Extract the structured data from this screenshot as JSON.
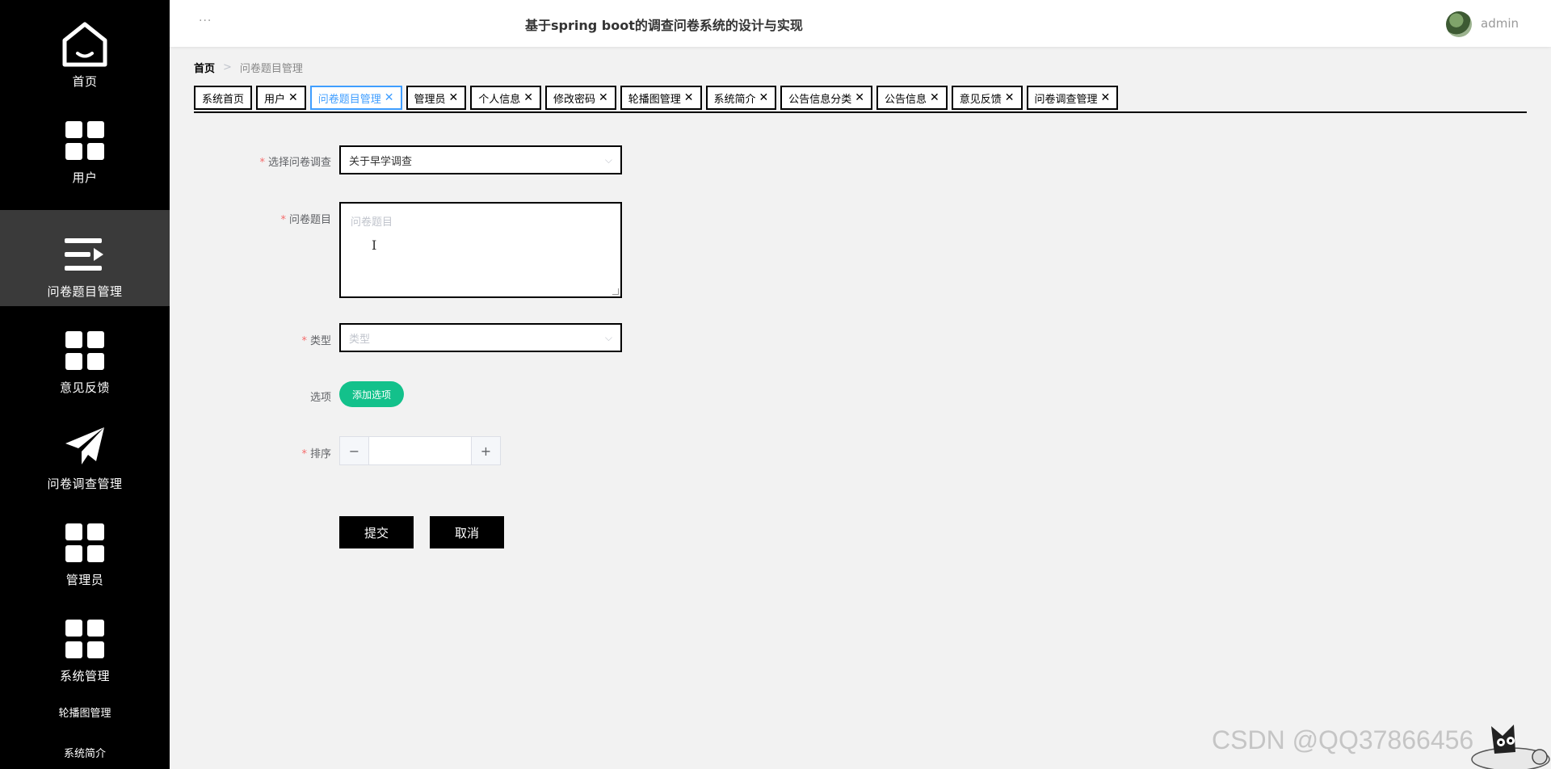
{
  "header": {
    "title": "基于spring boot的调查问卷系统的设计与实现",
    "username": "admin",
    "menu_dots": "···"
  },
  "sidebar": {
    "items": [
      {
        "label": "首页",
        "icon": "home-icon"
      },
      {
        "label": "用户",
        "icon": "grid-icon"
      },
      {
        "label": "问卷题目管理",
        "icon": "list-arrow-icon",
        "active": true
      },
      {
        "label": "意见反馈",
        "icon": "grid-icon"
      },
      {
        "label": "问卷调查管理",
        "icon": "paper-plane-icon"
      },
      {
        "label": "管理员",
        "icon": "grid-icon"
      },
      {
        "label": "系统管理",
        "icon": "grid-icon"
      }
    ],
    "subitems": [
      "轮播图管理",
      "系统简介"
    ]
  },
  "breadcrumb": {
    "home": "首页",
    "separator": ">",
    "current": "问卷题目管理"
  },
  "tabs": [
    {
      "label": "系统首页",
      "closable": false
    },
    {
      "label": "用户",
      "closable": true
    },
    {
      "label": "问卷题目管理",
      "closable": true,
      "active": true
    },
    {
      "label": "管理员",
      "closable": true
    },
    {
      "label": "个人信息",
      "closable": true
    },
    {
      "label": "修改密码",
      "closable": true
    },
    {
      "label": "轮播图管理",
      "closable": true
    },
    {
      "label": "系统简介",
      "closable": true
    },
    {
      "label": "公告信息分类",
      "closable": true
    },
    {
      "label": "公告信息",
      "closable": true
    },
    {
      "label": "意见反馈",
      "closable": true
    },
    {
      "label": "问卷调查管理",
      "closable": true
    }
  ],
  "tab_close": "✕",
  "form": {
    "survey": {
      "label": "选择问卷调查",
      "value": "关于早学调查"
    },
    "question": {
      "label": "问卷题目",
      "placeholder": "问卷题目"
    },
    "type": {
      "label": "类型",
      "placeholder": "类型"
    },
    "options": {
      "label": "选项",
      "add_button": "添加选项"
    },
    "sort": {
      "label": "排序",
      "value": "",
      "minus": "−",
      "plus": "+"
    },
    "required_mark": "*",
    "submit": "提交",
    "cancel": "取消"
  },
  "watermark": "CSDN @QQ37866456",
  "colors": {
    "sidebar_bg": "#000000",
    "sidebar_active": "#3a3a3a",
    "accent_tab": "#409eff",
    "add_button": "#13c18b",
    "required": "#f56c6c"
  }
}
